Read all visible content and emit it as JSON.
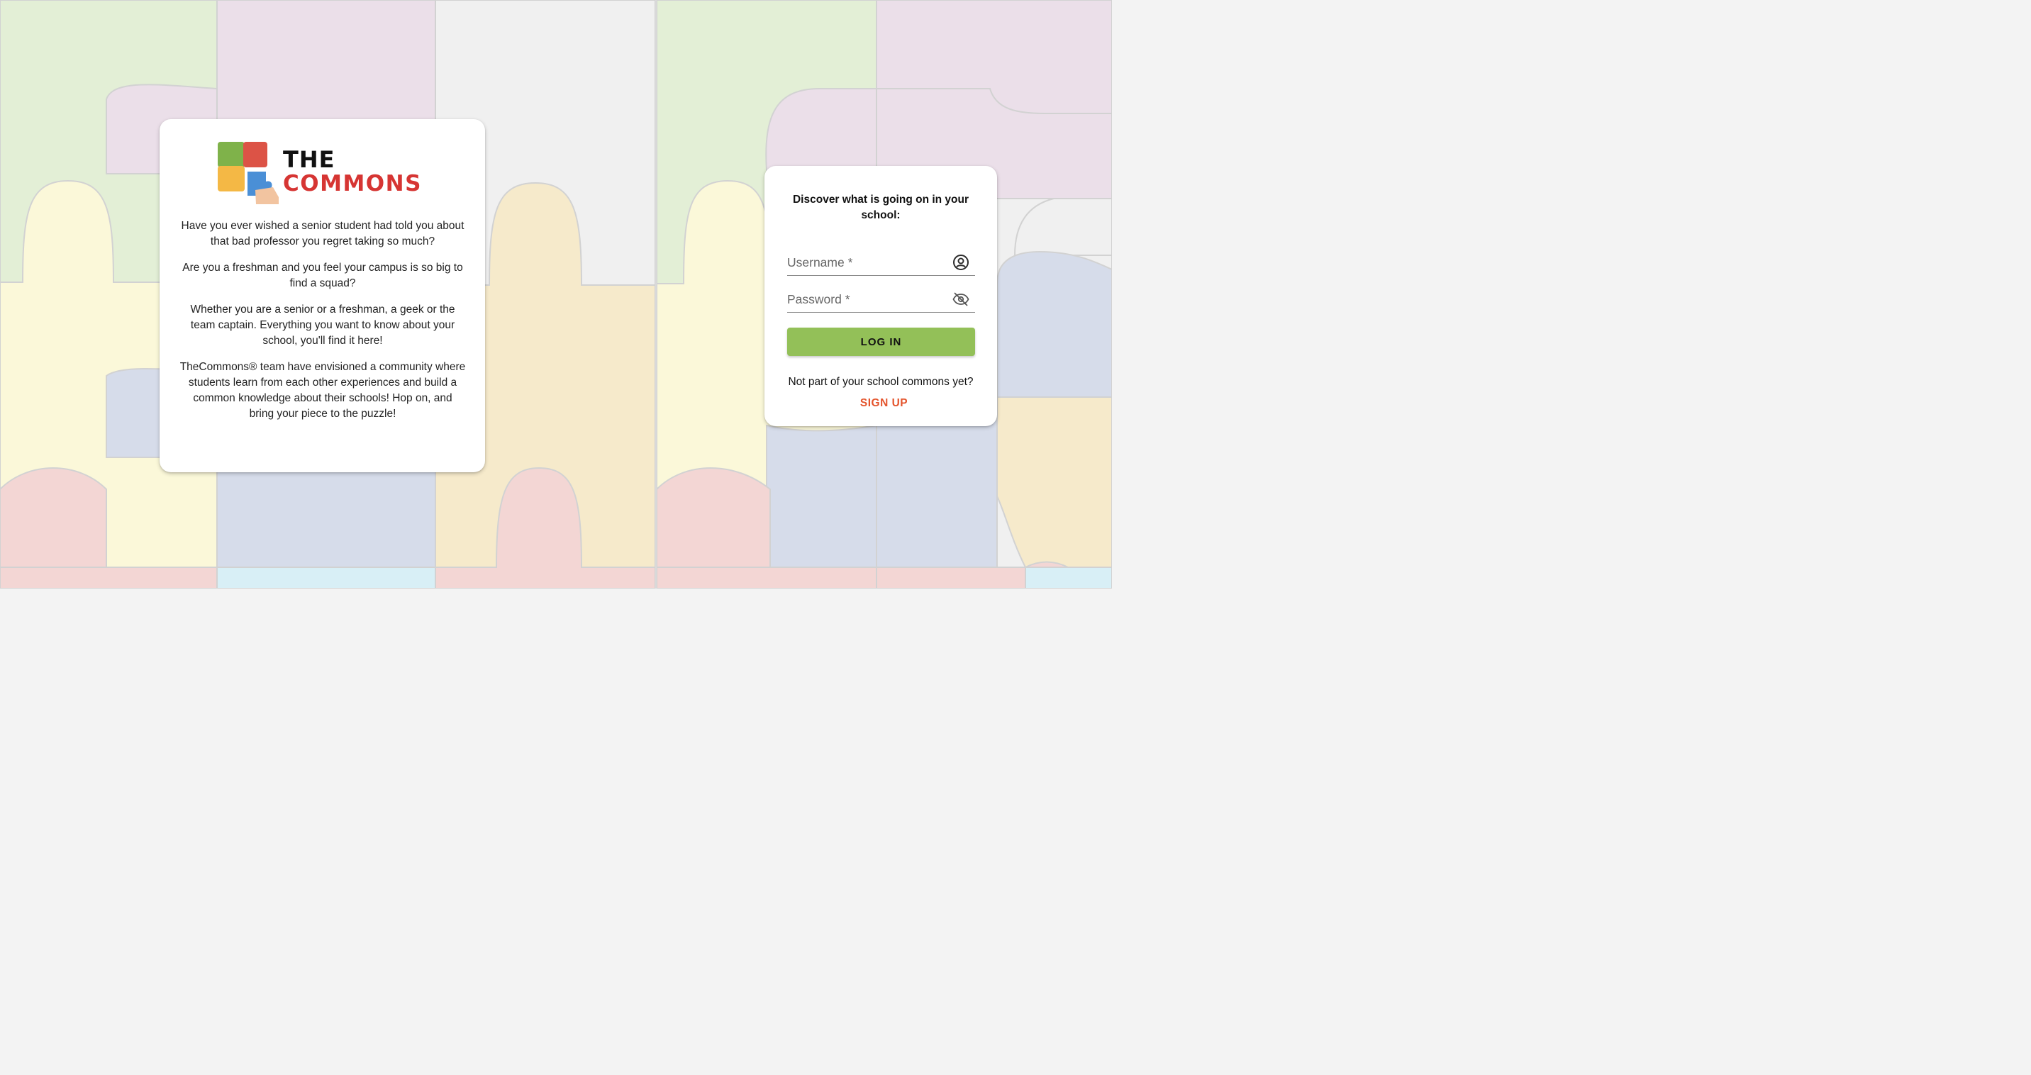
{
  "about": {
    "logo": {
      "word1": "THE",
      "word2": "COMMONS"
    },
    "paragraphs": [
      "Have you ever wished a senior student had told you about that bad professor you regret taking so much?",
      "Are you a freshman and you feel your campus is so big to find a squad?",
      "Whether you are a senior or a freshman, a geek or the team captain. Everything you want to know about your school, you'll find it here!",
      "TheCommons® team have envisioned a community where students learn from each other experiences and build a common knowledge about their schools! Hop on, and bring your piece to the puzzle!"
    ]
  },
  "login": {
    "heading": "Discover what is going on in your school:",
    "username": {
      "placeholder": "Username *",
      "value": "",
      "icon": "account-circle-icon"
    },
    "password": {
      "placeholder": "Password *",
      "value": "",
      "icon": "visibility-off-icon"
    },
    "submit_label": "LOG IN",
    "signup_prompt": "Not part of your school commons yet?",
    "signup_label": "SIGN UP"
  },
  "colors": {
    "accent_green": "#93c058",
    "signup_orange": "#e4542c",
    "logo_red": "#d63533",
    "piece_green": "#e3efd6",
    "piece_purple": "#ebdfe9",
    "piece_gray": "#f0f0f0",
    "piece_yellow": "#fbf8d9",
    "piece_tan": "#f6eacb",
    "piece_blue": "#d6dcea",
    "piece_pink": "#f3d6d4",
    "piece_cyan": "#d8eff6"
  }
}
